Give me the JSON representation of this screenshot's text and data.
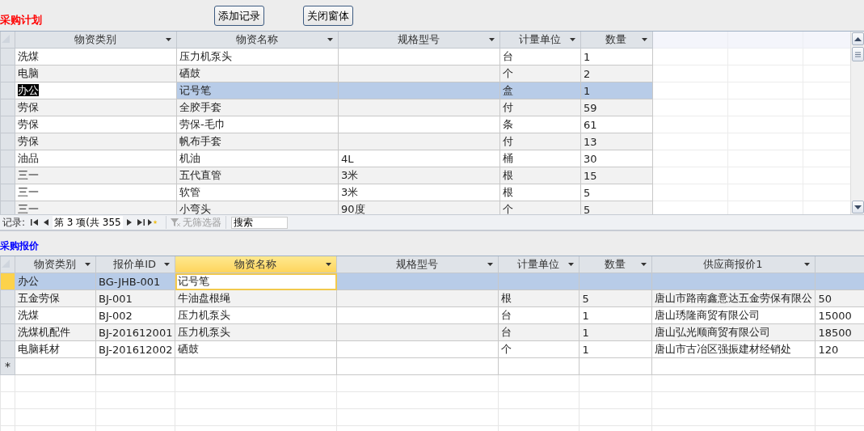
{
  "purchase_plan": {
    "title": "采购计划",
    "buttons": [
      "添加记录",
      "关闭窗体"
    ],
    "grid": {
      "active": false,
      "columns": [
        {
          "label": "物资类别",
          "focused": true
        },
        {
          "label": "物资名称",
          "focused": false
        },
        {
          "label": "规格型号",
          "focused": false
        },
        {
          "label": "计量单位",
          "focused": false
        },
        {
          "label": "数量",
          "focused": false
        }
      ],
      "rows": [
        {
          "selected": false,
          "cells": [
            "洗煤",
            "压力机泵头",
            null,
            "台",
            "1"
          ]
        },
        {
          "selected": false,
          "cells": [
            "电脑",
            "硒鼓",
            null,
            "个",
            "2"
          ]
        },
        {
          "selected": true,
          "cells": [
            "办公",
            "记号笔",
            null,
            "盒",
            "1"
          ]
        },
        {
          "selected": false,
          "cells": [
            "劳保",
            "全胶手套",
            null,
            "付",
            "59"
          ]
        },
        {
          "selected": false,
          "cells": [
            "劳保",
            "劳保-毛巾",
            null,
            "条",
            "61"
          ]
        },
        {
          "selected": false,
          "cells": [
            "劳保",
            "帆布手套",
            null,
            "付",
            "13"
          ]
        },
        {
          "selected": false,
          "cells": [
            "油品",
            "机油",
            "4L",
            "桶",
            "30"
          ]
        },
        {
          "selected": false,
          "cells": [
            "三一",
            "五代直管",
            "3米",
            "根",
            "15"
          ]
        },
        {
          "selected": false,
          "cells": [
            "三一",
            "软管",
            "3米",
            "根",
            "5"
          ]
        },
        {
          "selected": false,
          "cells": [
            "三一",
            "小弯头",
            "90度",
            "个",
            "5"
          ]
        }
      ]
    },
    "navigator": {
      "label": "记录:",
      "position": "第 3 项(共 355",
      "filter": {
        "label": "无筛选器",
        "disabled": true
      },
      "search_placeholder": "搜索"
    }
  },
  "purchase_quote": {
    "title": "采购报价",
    "grid": {
      "active": true,
      "new_row_marker": "*",
      "columns": [
        {
          "label": "物资类别",
          "focused": false
        },
        {
          "label": "报价单ID",
          "focused": false
        },
        {
          "label": "物资名称",
          "focused": true
        },
        {
          "label": "规格型号",
          "focused": false
        },
        {
          "label": "计量单位",
          "focused": false
        },
        {
          "label": "数量",
          "focused": false
        },
        {
          "label": "供应商报价1",
          "focused": false
        },
        {
          "focused": false
        }
      ],
      "rows": [
        {
          "selected": true,
          "cells": [
            "办公",
            "BG-JHB-001",
            "记号笔",
            null,
            null,
            null,
            null,
            null
          ]
        },
        {
          "selected": false,
          "cells": [
            "五金劳保",
            "BJ-001",
            "牛油盘根绳",
            null,
            "根",
            "5",
            "唐山市路南鑫意达五金劳保有限公",
            "50"
          ]
        },
        {
          "selected": false,
          "cells": [
            "洗煤",
            "BJ-002",
            "压力机泵头",
            null,
            "台",
            "1",
            "唐山琇隆商贸有限公司",
            "15000"
          ]
        },
        {
          "selected": false,
          "cells": [
            "洗煤机配件",
            "BJ-201612001",
            "压力机泵头",
            null,
            "台",
            "1",
            "唐山弘光顺商贸有限公司",
            "18500"
          ]
        },
        {
          "selected": false,
          "cells": [
            "电脑耗材",
            "BJ-201612002",
            "硒鼓",
            null,
            "个",
            "1",
            "唐山市古冶区强振建材经销处",
            "120"
          ]
        }
      ]
    }
  }
}
